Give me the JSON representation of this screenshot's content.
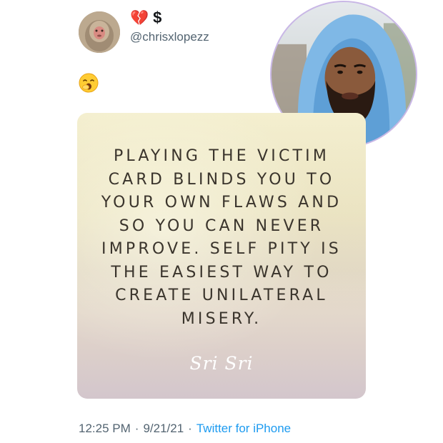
{
  "tweet": {
    "display_name_emoji": "💔",
    "display_name_symbol": "$",
    "handle": "@chrisxlopezz",
    "reaction_emoji": "yawning-face",
    "quote_lines": [
      "PLAYING THE VICTIM",
      "CARD BLINDS YOU TO",
      "YOUR OWN FLAWS AND",
      "SO YOU CAN NEVER",
      "IMPROVE. SELF PITY IS",
      "THE EASIEST WAY TO",
      "CREATE UNILATERAL",
      "MISERY."
    ],
    "quote_author": "Sri Sri",
    "time": "12:25 PM",
    "date": "9/21/21",
    "separator": "·",
    "source": "Twitter for iPhone"
  },
  "colors": {
    "handle": "#536471",
    "link": "#1d9bf0",
    "broken_heart": "#d0021b",
    "inset_border": "#c9b7e6"
  }
}
